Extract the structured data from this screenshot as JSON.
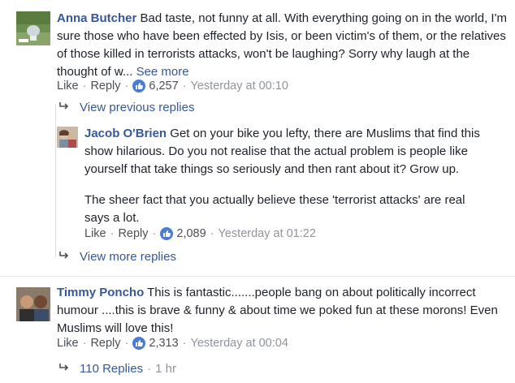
{
  "comments": [
    {
      "author": "Anna Butcher",
      "text": " Bad taste, not funny at all. With everything going on in the world, I'm sure those who have been effected by Isis, or been victim's of them, or the relatives of those killed in terrorists attacks, won't be laughing? Sorry why laugh at the thought of w... ",
      "see_more": "See more",
      "like_label": "Like",
      "reply_label": "Reply",
      "likes": "6,257",
      "timestamp": "Yesterday at 00:10"
    },
    {
      "author": "Jacob O'Brien",
      "text_line1": " Get on your bike you lefty, there are Muslims that find this show hilarious. Do you not realise that the actual problem is people like yourself that take things so seriously and then rant about it? Grow up.",
      "text_line2": "The sheer fact that you actually believe these 'terrorist attacks' are real says a lot.",
      "like_label": "Like",
      "reply_label": "Reply",
      "likes": "2,089",
      "timestamp": "Yesterday at 01:22"
    },
    {
      "author": "Timmy Poncho",
      "text": " This is fantastic.......people bang on about politically incorrect humour ....this is brave & funny & about time we poked fun at these morons! Even Muslims will love this!",
      "like_label": "Like",
      "reply_label": "Reply",
      "likes": "2,313",
      "timestamp": "Yesterday at 00:04"
    }
  ],
  "view_previous_replies": "View previous replies",
  "view_more_replies": "View more replies",
  "replies_count_label": "110 Replies",
  "replies_age": "1 hr",
  "separator": "·",
  "colors": {
    "link": "#365899",
    "meta": "#90949c",
    "like_badge": "#4a7bd5"
  }
}
